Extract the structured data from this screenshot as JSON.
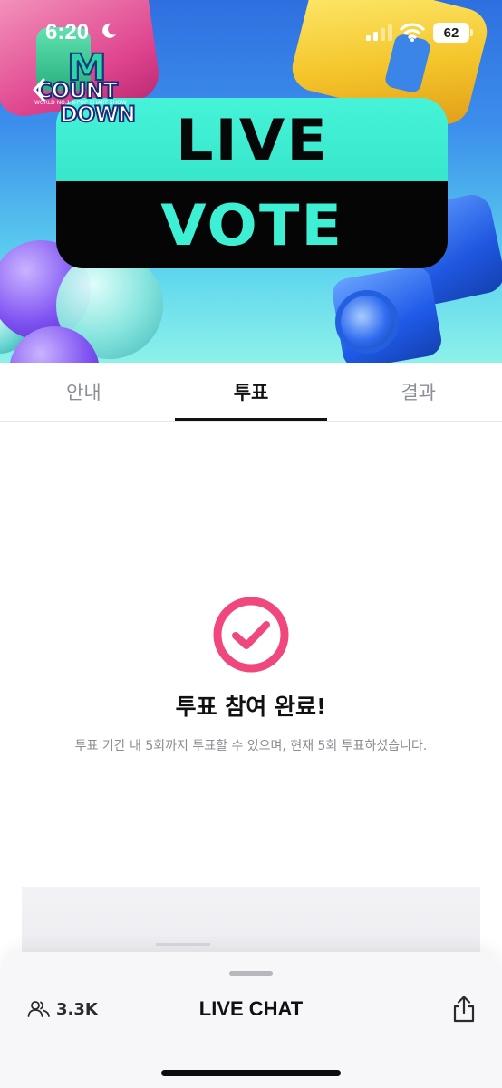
{
  "status_bar": {
    "time": "6:20",
    "battery": "62"
  },
  "banner": {
    "logo": {
      "m": "M",
      "line1": "COUNT",
      "line2": "DOWN",
      "tag": "WORLD NO.1 K-POP CHART SHOW"
    },
    "vote_card": {
      "top_text": "LIVE",
      "bottom_text": "VOTE"
    }
  },
  "tabs": [
    {
      "label": "안내",
      "active": false
    },
    {
      "label": "투표",
      "active": true
    },
    {
      "label": "결과",
      "active": false
    }
  ],
  "result": {
    "title": "투표 참여 완료!",
    "description": "투표 기간 내 5회까지 투표할 수 있으며, 현재 5회 투표하셨습니다."
  },
  "chat_sheet": {
    "viewer_count": "3.3K",
    "title": "LIVE CHAT"
  },
  "colors": {
    "accent_pink": "#f0477c",
    "vote_mint": "#3ef0d3"
  }
}
